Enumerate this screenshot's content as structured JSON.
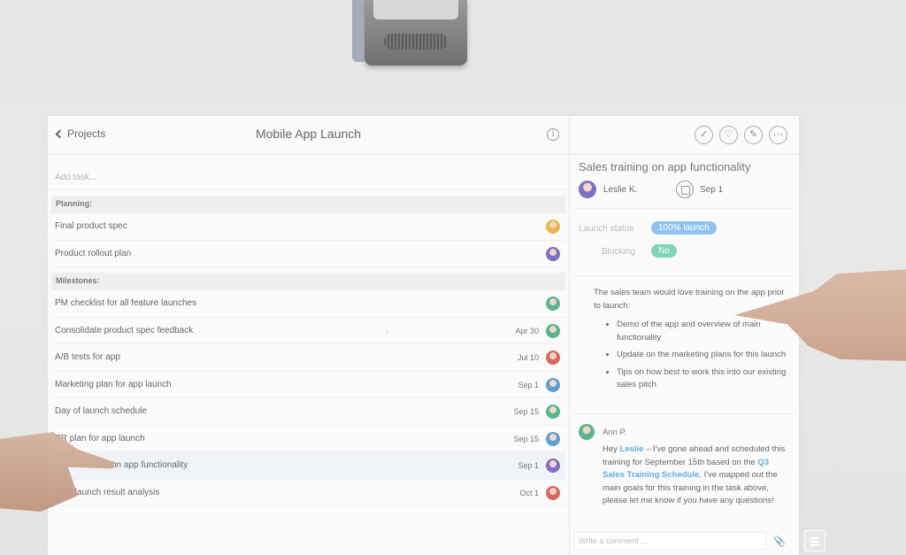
{
  "header": {
    "back_label": "Projects",
    "title": "Mobile App Launch",
    "info_glyph": "i"
  },
  "list": {
    "add_placeholder": "Add task...",
    "sections": [
      {
        "label": "Planning:",
        "tasks": [
          {
            "name": "Final product spec",
            "date": "",
            "avatar": "av-a"
          },
          {
            "name": "Product rollout plan",
            "date": "",
            "avatar": "av-b"
          }
        ]
      },
      {
        "label": "Milestones:",
        "tasks": [
          {
            "name": "PM checklist for all feature launches",
            "date": "",
            "avatar": "av-c"
          },
          {
            "name": "Consolidate product spec feedback",
            "date": "Apr 30",
            "avatar": "av-c"
          },
          {
            "name": "A/B tests for app",
            "date": "Jul 10",
            "avatar": "av-d"
          },
          {
            "name": "Marketing plan for app launch",
            "date": "Sep 1",
            "avatar": "av-e"
          },
          {
            "name": "Day of launch schedule",
            "date": "Sep 15",
            "avatar": "av-c"
          },
          {
            "name": "PR plan for app launch",
            "date": "Sep 15",
            "avatar": "av-e"
          },
          {
            "name": "on app functionality",
            "date": "Sep 1",
            "avatar": "av-b"
          },
          {
            "name": "Post launch result analysis",
            "date": "Oct 1",
            "avatar": "av-d"
          }
        ]
      }
    ]
  },
  "detail": {
    "icons": {
      "complete": "✓",
      "like": "♡",
      "edit": "✎",
      "more": "⋯"
    },
    "title": "Sales training on app functionality",
    "assignee": "Leslie K.",
    "due_date": "Sep 1",
    "fields": [
      {
        "label": "Launch status",
        "value": "100% launch"
      },
      {
        "label": "Blocking",
        "value": "No"
      }
    ],
    "description": {
      "intro": "The sales team would love training on the app prior to launch:",
      "bullets": [
        "Demo of the app and overview of main functionality",
        "Update on the marketing plans for this launch",
        "Tips on how best to work this into our existing sales pitch"
      ]
    },
    "comment": {
      "author": "Ann P.",
      "pre": "Hey ",
      "mention": "Leslie",
      "mid": " – I've gone ahead and scheduled this training for September 15th based on the ",
      "link": "Q3 Sales Training Schedule",
      "post": ". I've mapped out the main goals for this training in the task above, please let me know if you have any questions!"
    },
    "composer_placeholder": "Write a comment ...",
    "attach_glyph": "📎"
  },
  "colors": {
    "status_pill": "#8fc2f0",
    "blocking_pill": "#7ed6b9",
    "link": "#5aaee8"
  }
}
